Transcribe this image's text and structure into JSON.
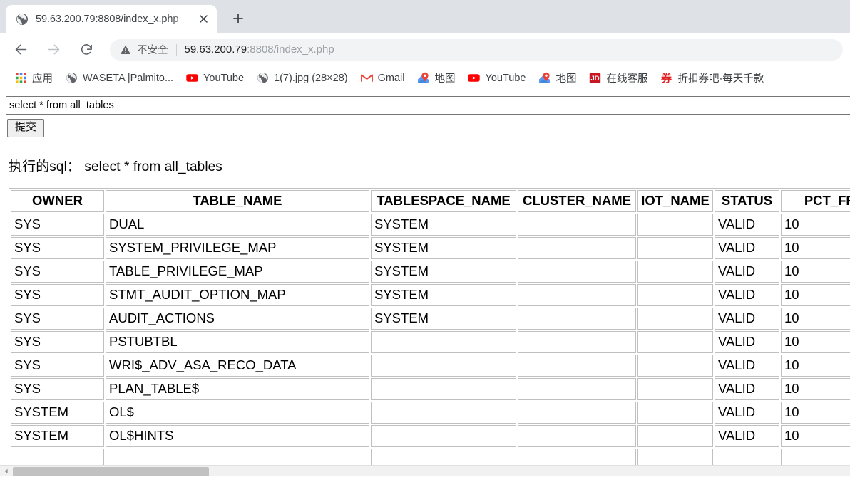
{
  "browser": {
    "tab": {
      "favicon": "globe-icon",
      "title": "59.63.200.79:8808/index_x.php",
      "close_label": "✕"
    },
    "newtab_label": "+",
    "toolbar": {
      "back_label": "←",
      "forward_label": "→",
      "reload_label": "↻",
      "security_icon": "warning-triangle-icon",
      "security_text": "不安全",
      "url_host": "59.63.200.79",
      "url_path": ":8808/index_x.php"
    },
    "bookmarks": [
      {
        "icon": "apps-grid-icon",
        "label": "应用"
      },
      {
        "icon": "globe-icon",
        "label": "WASETA |Palmito..."
      },
      {
        "icon": "youtube-icon",
        "label": "YouTube"
      },
      {
        "icon": "globe-icon",
        "label": "1(7).jpg (28×28)"
      },
      {
        "icon": "gmail-icon",
        "label": "Gmail"
      },
      {
        "icon": "maps-icon",
        "label": "地图"
      },
      {
        "icon": "youtube-icon",
        "label": "YouTube"
      },
      {
        "icon": "maps-icon",
        "label": "地图"
      },
      {
        "icon": "jd-icon",
        "label": "在线客服"
      },
      {
        "icon": "coupon-icon",
        "label": "折扣券吧-每天千款"
      }
    ]
  },
  "page": {
    "sql_input_value": "select * from all_tables",
    "sql_input_placeholder": "",
    "submit_label": "提交",
    "executed_label": "执行的sql： select * from all_tables",
    "table": {
      "columns": [
        "OWNER",
        "TABLE_NAME",
        "TABLESPACE_NAME",
        "CLUSTER_NAME",
        "IOT_NAME",
        "STATUS",
        "PCT_FRE"
      ],
      "rows": [
        [
          "SYS",
          "DUAL",
          "SYSTEM",
          "",
          "",
          "VALID",
          "10"
        ],
        [
          "SYS",
          "SYSTEM_PRIVILEGE_MAP",
          "SYSTEM",
          "",
          "",
          "VALID",
          "10"
        ],
        [
          "SYS",
          "TABLE_PRIVILEGE_MAP",
          "SYSTEM",
          "",
          "",
          "VALID",
          "10"
        ],
        [
          "SYS",
          "STMT_AUDIT_OPTION_MAP",
          "SYSTEM",
          "",
          "",
          "VALID",
          "10"
        ],
        [
          "SYS",
          "AUDIT_ACTIONS",
          "SYSTEM",
          "",
          "",
          "VALID",
          "10"
        ],
        [
          "SYS",
          "PSTUBTBL",
          "",
          "",
          "",
          "VALID",
          "10"
        ],
        [
          "SYS",
          "WRI$_ADV_ASA_RECO_DATA",
          "",
          "",
          "",
          "VALID",
          "10"
        ],
        [
          "SYS",
          "PLAN_TABLE$",
          "",
          "",
          "",
          "VALID",
          "10"
        ],
        [
          "SYSTEM",
          "OL$",
          "",
          "",
          "",
          "VALID",
          "10"
        ],
        [
          "SYSTEM",
          "OL$HINTS",
          "",
          "",
          "",
          "VALID",
          "10"
        ],
        [
          "",
          "",
          "",
          "",
          "",
          "",
          ""
        ]
      ]
    },
    "scrollbar": {
      "left_arrow_label": "◀"
    }
  },
  "colors": {
    "tabstrip_bg": "#dee1e6",
    "omnibox_bg": "#f1f3f4",
    "url_host": "#202124",
    "url_path": "#9aa0a6",
    "table_border": "#c0c0c0",
    "scroll_thumb": "#c1c1c1",
    "youtube_red": "#ff0000",
    "gmail_red": "#ea4335",
    "jd_red": "#c81623",
    "coupon_red": "#e02020"
  }
}
